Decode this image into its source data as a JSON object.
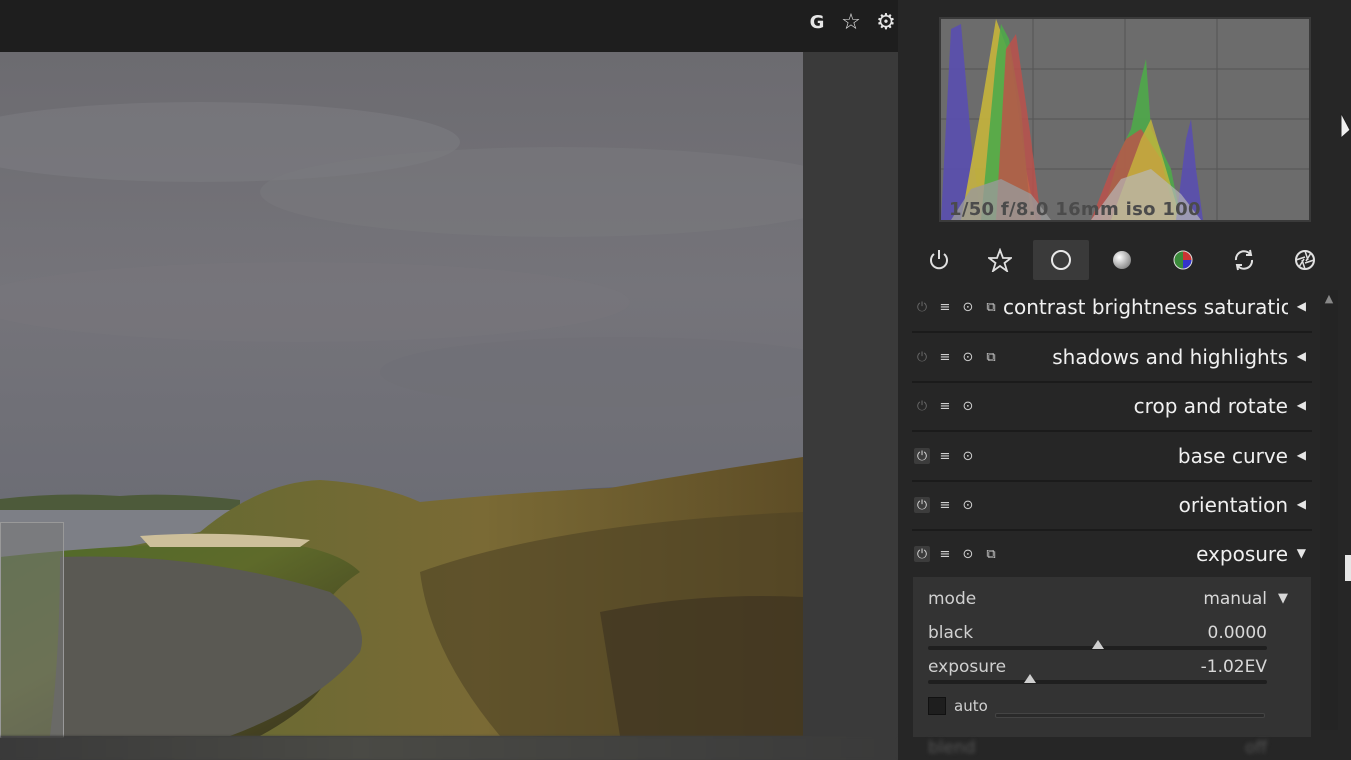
{
  "topbar": {
    "icons": [
      {
        "name": "grouping-icon",
        "glyph": "G"
      },
      {
        "name": "star-icon",
        "glyph": "☆"
      },
      {
        "name": "gear-icon",
        "glyph": "⚙"
      }
    ]
  },
  "histogram": {
    "exif": "1/50 f/8.0 16mm iso 100"
  },
  "module_groups": [
    {
      "name": "power-icon",
      "active": false
    },
    {
      "name": "favorites-star-icon",
      "active": false
    },
    {
      "name": "basic-circle-icon",
      "active": true
    },
    {
      "name": "tone-gradient-icon",
      "active": false
    },
    {
      "name": "color-wheel-icon",
      "active": false
    },
    {
      "name": "correct-rotate-icon",
      "active": false
    },
    {
      "name": "effects-aperture-icon",
      "active": false
    }
  ],
  "modules": [
    {
      "label": "contrast brightness saturation",
      "enabled": false,
      "has_instance": true,
      "arrow": "◀"
    },
    {
      "label": "shadows and highlights",
      "enabled": false,
      "has_instance": true,
      "arrow": "◀"
    },
    {
      "label": "crop and rotate",
      "enabled": false,
      "has_instance": false,
      "arrow": "◀"
    },
    {
      "label": "base curve",
      "enabled": true,
      "has_instance": false,
      "arrow": "◀"
    },
    {
      "label": "orientation",
      "enabled": true,
      "has_instance": false,
      "arrow": "◀"
    },
    {
      "label": "exposure",
      "enabled": true,
      "has_instance": true,
      "arrow": "▼"
    }
  ],
  "exposure_panel": {
    "mode_label": "mode",
    "mode_value": "manual",
    "black_label": "black",
    "black_value": "0.0000",
    "black_position": 0.5,
    "exposure_label": "exposure",
    "exposure_value": "-1.02EV",
    "exposure_position": 0.3,
    "auto_label": "auto",
    "blend_label": "blend",
    "blend_value": "off"
  },
  "colors": {
    "accent": "#e6e6e6",
    "panel": "#262626",
    "histogram_bg": "#6c6c6c"
  }
}
